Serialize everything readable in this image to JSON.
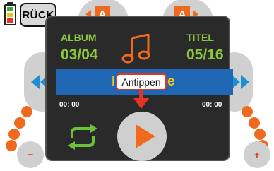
{
  "header": {
    "back_label": "RÜCK",
    "tab_left_label": "A",
    "tab_right_label": "A"
  },
  "album": {
    "label": "ALBUM",
    "value": "03/04"
  },
  "title": {
    "label": "TITEL",
    "value": "05/16"
  },
  "track_name_partial": {
    "left": "I",
    "right": "e"
  },
  "tooltip": {
    "text": "Antippen"
  },
  "time": {
    "elapsed": "00: 00",
    "total": "00: 00"
  },
  "volume": {
    "minus": "−",
    "plus": "+"
  },
  "colors": {
    "accent": "#f06a1e",
    "label_green": "#8bc53f",
    "track_bar": "#1f66b3",
    "panel": "#2a2a2a",
    "tooltip_border": "#e23324"
  },
  "icons": [
    "battery-icon",
    "music-note-icon",
    "rewind-icon",
    "fast-forward-icon",
    "repeat-icon",
    "play-icon",
    "arrow-down-icon"
  ]
}
